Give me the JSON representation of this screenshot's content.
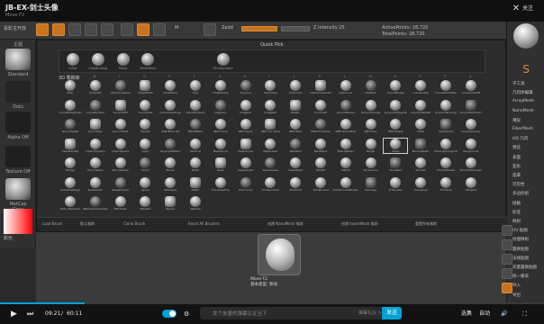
{
  "window": {
    "title": "JB-EX-剑士头像",
    "subtitle": "Move F2",
    "close_icon": "close-icon",
    "follow_label": "关注"
  },
  "toolbar": {
    "labels": [
      "投影主开放",
      "Edit",
      "Draw",
      "Move",
      "Scale",
      "Rotate",
      "Mrgb",
      "Rgb",
      "M",
      "Zadd",
      "Zsub",
      "Focal Shift 0",
      "Draw Size 64",
      "Z Intensity 25",
      "ActivePoints: 28,720",
      "TotalPoints: 28,720"
    ]
  },
  "left_panel": {
    "items": [
      "主题",
      "Standard",
      "Dots",
      "Alpha Off",
      "Texture Off",
      "MatCap Gray"
    ],
    "color_swatch": "颜色"
  },
  "right_panel": {
    "items": [
      "子工具",
      "几何体编辑",
      "ArrayMesh",
      "NanoMesh",
      "薄层",
      "FiberMesh",
      "HD 几何",
      "预览",
      "表面",
      "变形",
      "遮罩",
      "可见性",
      "多边形组",
      "接触",
      "形变",
      "映射",
      "UV 贴图",
      "纹理映射",
      "置换贴图",
      "法线贴图",
      "矢量置换贴图",
      "统一蒙皮",
      "导入",
      "导出"
    ]
  },
  "dialog": {
    "title": "Quick Pick",
    "quick_pick": [
      "Inflat",
      "ClayBuildup",
      "Move",
      "SelectRect",
      "",
      "",
      "TrimDynamic",
      "",
      "",
      "",
      "",
      "",
      "",
      "",
      "",
      "",
      ""
    ],
    "grid_header": "3D 笔刷库",
    "columns": [
      "A",
      "B",
      "C",
      "D",
      "E",
      "F",
      "G",
      "H",
      "I",
      "J",
      "K",
      "L",
      "M",
      "N",
      "O",
      "P",
      "Q"
    ],
    "brushes": [
      [
        "Blob",
        "Chisel3D",
        "ChiselCreature",
        "ChiselEarth",
        "ChiselFace",
        "Clay",
        "ClayBuildup",
        "ClayLine",
        "ClayTubes",
        "ClipCircle",
        "ClipCircleCenter",
        "ClipCurve",
        "ClipRect",
        "CurveBridge",
        "CurveLathe",
        "CurveMultiTube",
        "CurveQuadFill"
      ],
      [
        "CurveStrapSnap",
        "CurveSurface",
        "CurveTriFill",
        "CurveTube",
        "CurveTubeSnap",
        "Damstandard",
        "Displace",
        "DragDot",
        "DragRect",
        "Elastic",
        "FormSoft",
        "GroomBlower",
        "GroomClumps",
        "GroomerMagnet",
        "GroomHairBall",
        "GroomHairLong",
        "GroomHairShort"
      ],
      [
        "GroomSpike",
        "GroomSpin",
        "GroomTwist",
        "Hpolish",
        "IMM Basic Kit",
        "IMM BParts",
        "IMM Curve",
        "IMM Gears",
        "IMM Ind. Parts",
        "IMM Parts",
        "IMM Primitives",
        "IMM SpaceShip",
        "IMM Toon",
        "IMM Zipper",
        "Inflat",
        "InsertCube",
        "InsertCylinder"
      ],
      [
        "InsertHCube",
        "InsertHSphere",
        "InsertSphere",
        "Layer",
        "LayeredPattern",
        "MAHcut",
        "MaskCircle",
        "MaskCurve",
        "MaskLasso",
        "MaskPen",
        "MaskRect",
        "MatchMaker",
        "Morph",
        "Move",
        "Move Elastic",
        "Move Topological",
        "MoveCurve"
      ],
      [
        "Nudge",
        "Orb_Flatten",
        "Pen Shadow",
        "Pinch",
        "Planar",
        "Polish",
        "Rake",
        "ReplayLast",
        "SelectLasso",
        "SelectRect",
        "sPolish",
        "Slash3",
        "SliceCurve",
        "SliceRect",
        "Smooth",
        "SmoothPeaks",
        "SmoothStronger"
      ],
      [
        "SmoothValleys",
        "Snakehook",
        "SnakeHook2",
        "Spiral",
        "Standard",
        "Stitch",
        "TrimAdaptive",
        "TrimCurve",
        "TrimDynamic",
        "TrimFront",
        "TrimNormal",
        "TrimSmoothBorder",
        "Topology",
        "TrimLasso",
        "Transpose",
        "TrimHole",
        "ZProject"
      ],
      [
        "Dam_Standard",
        "ZRemesherGuides",
        "ZModeler",
        "ZSketch",
        "Zipper",
        "Weavel",
        "",
        "",
        "",
        "",
        "",
        "",
        "",
        "",
        "",
        "",
        ""
      ]
    ],
    "footer": [
      "Load Brush",
      "默认笔刷",
      "Clone Brush",
      "Reset All Brushes",
      "创建 NanoMesh 笔刷",
      "创建 InsertMesh 笔刷",
      "重置所有笔刷"
    ]
  },
  "viewport": {
    "preview_name": "Move F2",
    "preview_desc": "基本类型: 移动"
  },
  "player": {
    "time_current": "09:21",
    "time_total": "60:11",
    "danmaku_placeholder": "发个友善的弹幕见证当下",
    "danmaku_rule": "弹幕礼仪 >",
    "send_label": "发送",
    "quality_label": "选集",
    "auto_label": "自动",
    "speed_label": "倍速",
    "progress": 0.155,
    "accent_color": "#00a1d6",
    "brand_color": "#c8741f"
  }
}
